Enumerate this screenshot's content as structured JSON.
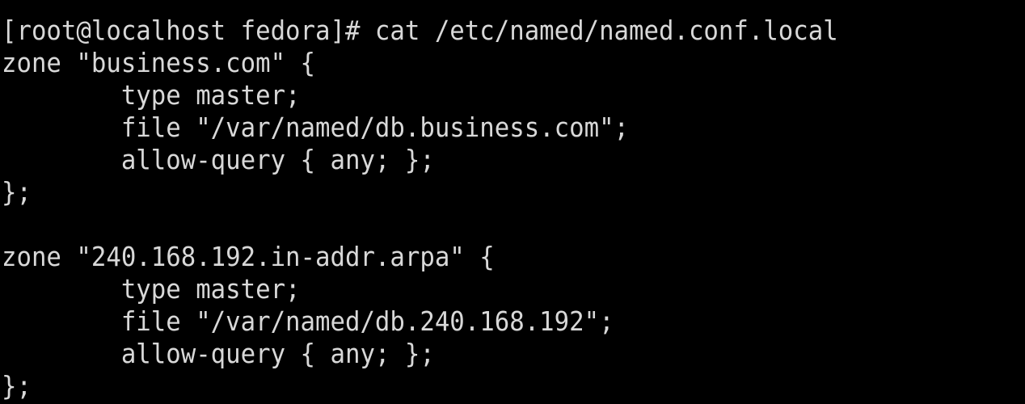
{
  "terminal": {
    "lines": [
      "[root@localhost fedora]# cat /etc/named/named.conf.local",
      "zone \"business.com\" {",
      "        type master;",
      "        file \"/var/named/db.business.com\";",
      "        allow-query { any; };",
      "};",
      "",
      "zone \"240.168.192.in-addr.arpa\" {",
      "        type master;",
      "        file \"/var/named/db.240.168.192\";",
      "        allow-query { any; };",
      "};"
    ]
  },
  "colors": {
    "background": "#000000",
    "foreground": "#d8d8d8"
  }
}
